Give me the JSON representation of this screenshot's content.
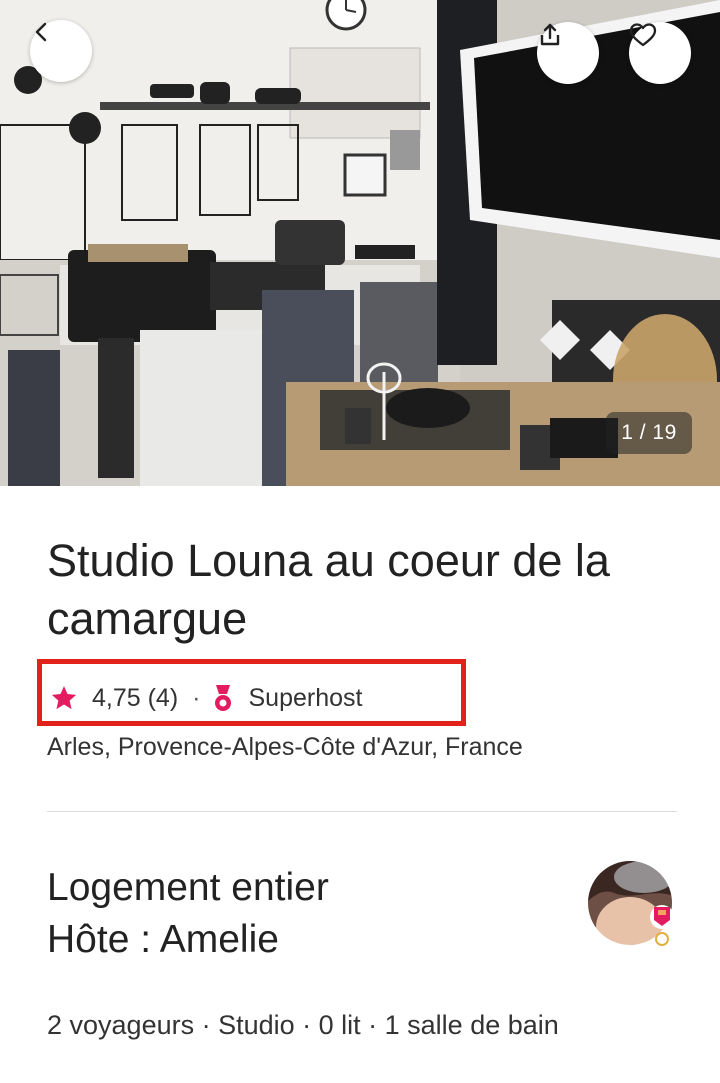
{
  "photo": {
    "alt": "Studio kitchen and dining area",
    "counter": "1 / 19"
  },
  "nav": {
    "back_icon": "chevron-left-icon",
    "share_icon": "share-icon",
    "favorite_icon": "heart-icon"
  },
  "listing": {
    "title": "Studio Louna au coeur de la camargue",
    "rating": "4,75 (4)",
    "separator": "·",
    "superhost_label": "Superhost",
    "location": "Arles, Provence-Alpes-Côte d'Azur, France"
  },
  "host": {
    "type_line": "Logement entier",
    "host_line": "Hôte : Amelie",
    "details": "2 voyageurs · Studio · 0 lit · 1 salle de bain"
  },
  "colors": {
    "accent": "#e31c5f",
    "highlight": "#e0221b",
    "text": "#222222"
  }
}
